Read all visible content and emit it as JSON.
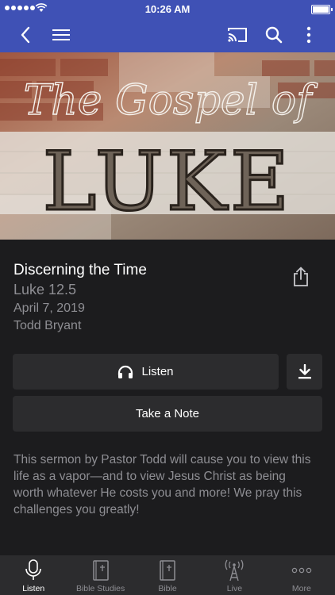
{
  "status_bar": {
    "time": "10:26 AM"
  },
  "nav": {
    "back_icon": "chevron-left-icon",
    "menu_icon": "hamburger-menu-icon",
    "cast_icon": "cast-icon",
    "search_icon": "search-icon",
    "more_icon": "more-vertical-icon",
    "bar_color": "#3f51b5"
  },
  "hero": {
    "line1": "The Gospel of",
    "line2": "LUKE"
  },
  "sermon": {
    "title": "Discerning the Time",
    "scripture": "Luke 12.5",
    "date": "April 7, 2019",
    "speaker": "Todd Bryant",
    "description": "This sermon by Pastor Todd will cause you to view this life as a vapor—and to view Jesus Christ as being worth whatever He costs you and more! We pray this challenges you greatly!"
  },
  "actions": {
    "listen_label": "Listen",
    "note_label": "Take a Note",
    "download_icon": "download-icon",
    "share_icon": "share-icon"
  },
  "tabs": [
    {
      "label": "Listen",
      "icon": "microphone-icon",
      "active": true
    },
    {
      "label": "Bible Studies",
      "icon": "book-icon",
      "active": false
    },
    {
      "label": "Bible",
      "icon": "bible-icon",
      "active": false
    },
    {
      "label": "Live",
      "icon": "broadcast-tower-icon",
      "active": false
    },
    {
      "label": "More",
      "icon": "more-horizontal-icon",
      "active": false
    }
  ]
}
